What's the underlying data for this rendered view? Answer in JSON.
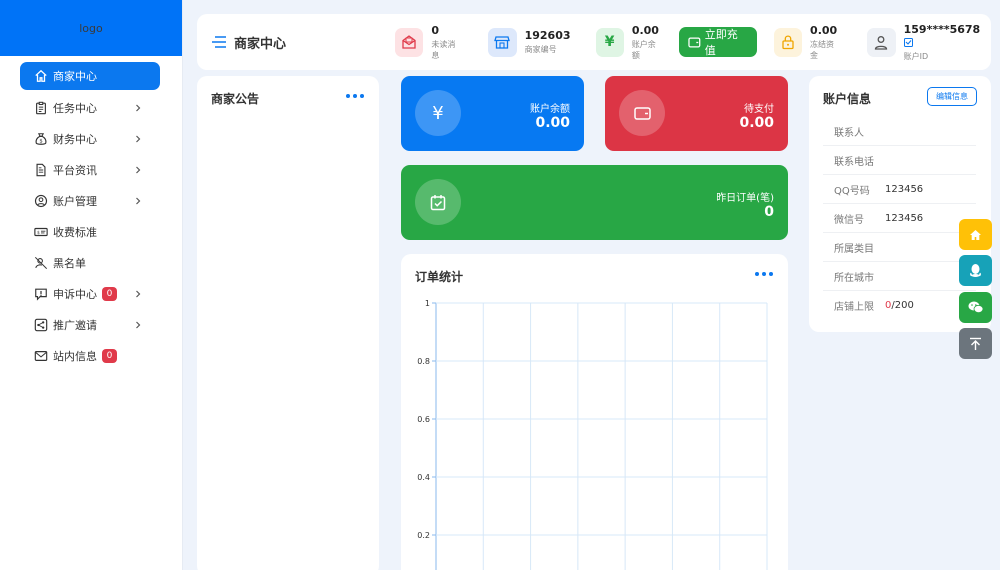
{
  "logo": "logo",
  "menu": [
    {
      "label": "商家中心",
      "icon": "home-icon",
      "active": true
    },
    {
      "label": "任务中心",
      "icon": "clipboard-icon",
      "chevron": true
    },
    {
      "label": "财务中心",
      "icon": "money-bag-icon",
      "chevron": true
    },
    {
      "label": "平台资讯",
      "icon": "document-icon",
      "chevron": true
    },
    {
      "label": "账户管理",
      "icon": "user-circle-icon",
      "chevron": true
    },
    {
      "label": "收费标准",
      "icon": "price-tag-icon"
    },
    {
      "label": "黑名单",
      "icon": "blocked-user-icon"
    },
    {
      "label": "申诉中心",
      "icon": "alert-message-icon",
      "badge": "0",
      "chevron": true
    },
    {
      "label": "推广邀请",
      "icon": "share-icon",
      "chevron": true
    },
    {
      "label": "站内信息",
      "icon": "mail-icon",
      "badge": "0"
    }
  ],
  "topbar": {
    "title": "商家中心",
    "stats": {
      "messages": {
        "value": "0",
        "label": "未读消息"
      },
      "merchant_no": {
        "value": "192603",
        "label": "商家编号"
      },
      "balance": {
        "value": "0.00",
        "label": "账户余额"
      },
      "frozen": {
        "value": "0.00",
        "label": "冻结资金"
      },
      "account": {
        "value": "159****5678",
        "label": "账户ID"
      }
    },
    "recharge_label": "立即充值"
  },
  "notice": {
    "title": "商家公告"
  },
  "tiles": {
    "balance": {
      "label": "账户余额",
      "value": "0.00"
    },
    "pending": {
      "label": "待支付",
      "value": "0.00"
    },
    "orders_yesterday": {
      "label": "昨日订单(笔)",
      "value": "0"
    }
  },
  "orders_chart": {
    "title": "订单统计"
  },
  "chart_data": {
    "type": "line",
    "title": "订单统计",
    "ylim": [
      0,
      1
    ],
    "yticks": [
      "1",
      "0.8",
      "0.6",
      "0.4",
      "0.2"
    ],
    "series": [],
    "grid": true
  },
  "account_info": {
    "title": "账户信息",
    "edit_label": "编辑信息",
    "rows": [
      {
        "key": "联系人",
        "value": ""
      },
      {
        "key": "联系电话",
        "value": ""
      },
      {
        "key": "QQ号码",
        "value": "123456"
      },
      {
        "key": "微信号",
        "value": "123456"
      },
      {
        "key": "所属类目",
        "value": ""
      },
      {
        "key": "所在城市",
        "value": ""
      }
    ],
    "shop_limit": {
      "key": "店铺上限",
      "used": "0",
      "total": "/200"
    }
  },
  "colors": {
    "primary": "#0b78ef",
    "red": "#dc3545",
    "green": "#28a745",
    "orange": "#ffc107",
    "teal": "#17a2b8",
    "gray": "#6c757d"
  }
}
